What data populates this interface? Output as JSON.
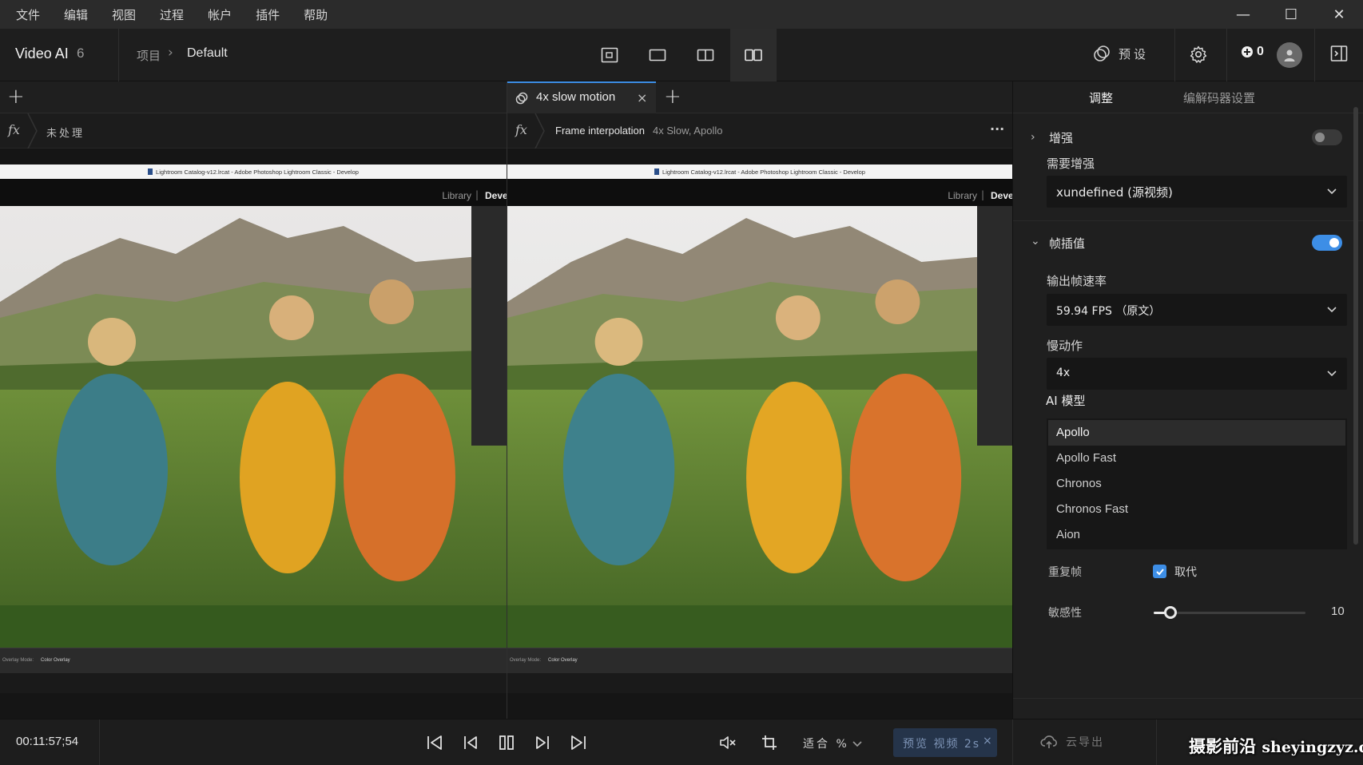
{
  "menu": [
    "文件",
    "编辑",
    "视图",
    "过程",
    "帐户",
    "插件",
    "帮助"
  ],
  "window_controls": {
    "minimize": "—",
    "maximize": "☐",
    "close": "✕"
  },
  "header": {
    "app_title": "Video AI",
    "app_version": "6",
    "breadcrumb_root": "项目",
    "breadcrumb_chevron": "›",
    "breadcrumb_current": "Default",
    "preset_label": "预设",
    "credits": "0",
    "view_modes": [
      "crop-view-icon",
      "single-view-icon",
      "split-view-icon",
      "side-by-side-view-icon"
    ],
    "active_view_mode": "side-by-side-view-icon"
  },
  "left_pane": {
    "add_tab": "+",
    "fx_label": "fx",
    "status": "未处理"
  },
  "right_pane": {
    "tab_label": "4x slow motion",
    "tab_close": "×",
    "add_tab": "+",
    "fx_label": "fx",
    "filter_name": "Frame interpolation",
    "filter_detail": "4x Slow, Apollo",
    "more": "···"
  },
  "preview": {
    "lr_title": "Lightroom Catalog-v12.lrcat - Adobe Photoshop Lightroom Classic - Develop",
    "lr_library": "Library",
    "lr_pipe": "|",
    "lr_develop": "Deve",
    "lr_overlay_label": "Overlay Mode:",
    "lr_overlay_value": "Color Overlay"
  },
  "panel": {
    "tabs": [
      "调整",
      "编解码器设置"
    ],
    "active_tab": "调整",
    "enhance": {
      "title": "增强",
      "enabled": false,
      "chevron": "›"
    },
    "need_enhance_label": "需要增强",
    "need_enhance_value": "xundefined (源视频)",
    "interp": {
      "title": "帧插值",
      "enabled": true,
      "chevron": "⌄"
    },
    "fps_label": "输出帧速率",
    "fps_value": "59.94 FPS （原文）",
    "slowmo_label": "慢动作",
    "slowmo_value": "4x",
    "model_label": "AI 模型",
    "models": [
      "Apollo",
      "Apollo Fast",
      "Chronos",
      "Chronos Fast",
      "Aion"
    ],
    "selected_model": "Apollo",
    "duplicate_label": "重复帧",
    "replace_label": "取代",
    "replace_checked": true,
    "sensitivity_label": "敏感性",
    "sensitivity_value": "10",
    "sensitivity_fraction": 0.11
  },
  "bottom": {
    "timecode": "00:11:57;54",
    "fit_label": "适合 %",
    "preview_button": "预览 视频 2s",
    "preview_close": "×",
    "export_label": "云导出"
  },
  "watermark": {
    "cn": "摄影前沿",
    "url": "sheyingzyz.com"
  },
  "colors": {
    "accent": "#3d8ee6",
    "background": "#1b1b1b",
    "panel": "#1f1f1f"
  }
}
